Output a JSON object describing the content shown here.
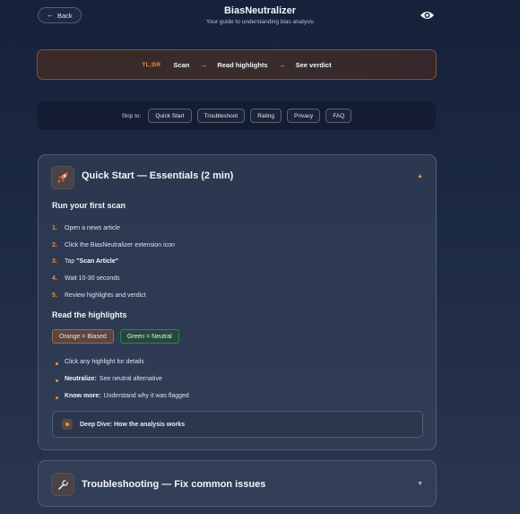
{
  "header": {
    "back_label": "Back",
    "title": "BiasNeutralizer",
    "subtitle": "Your guide to understanding bias analysis"
  },
  "tldr": {
    "tag": "TL;DR",
    "steps": [
      "Scan",
      "Read highlights",
      "See verdict"
    ],
    "separator": "→"
  },
  "skip": {
    "label": "Skip to:",
    "links": [
      "Quick Start",
      "Troubleshoot",
      "Rating",
      "Privacy",
      "FAQ"
    ]
  },
  "quickstart": {
    "title": "Quick Start — Essentials (2 min)",
    "scan_heading": "Run your first scan",
    "steps": [
      {
        "num": "1.",
        "text": "Open a news article"
      },
      {
        "num": "2.",
        "text": "Click the BiasNeutralizer extension icon"
      },
      {
        "num": "3.",
        "prefix": "Tap ",
        "strong": "\"Scan Article\""
      },
      {
        "num": "4.",
        "text": "Wait 10-30 seconds"
      },
      {
        "num": "5.",
        "text": "Review highlights and verdict"
      }
    ],
    "highlights_heading": "Read the highlights",
    "legend": {
      "orange": "Orange = Biased",
      "green": "Green = Neutral"
    },
    "bullets": [
      {
        "strong": "",
        "text": "Click any highlight for details"
      },
      {
        "strong": "Neutralize:",
        "text": "See neutral alternative"
      },
      {
        "strong": "Know more:",
        "text": "Understand why it was flagged"
      }
    ],
    "deep_dive": "Deep Dive: How the analysis works"
  },
  "troubleshooting": {
    "title": "Troubleshooting — Fix common issues"
  },
  "colors": {
    "accent": "#f0913a",
    "green": "#3e7a5d",
    "background": "#1d2a44"
  },
  "icons": {
    "back": "arrow-left-icon",
    "eye": "eye-icon",
    "quickstart": "rocket-icon",
    "troubleshooting": "wrench-icon",
    "expanded": "caret-up-icon",
    "collapsed": "caret-down-icon"
  }
}
